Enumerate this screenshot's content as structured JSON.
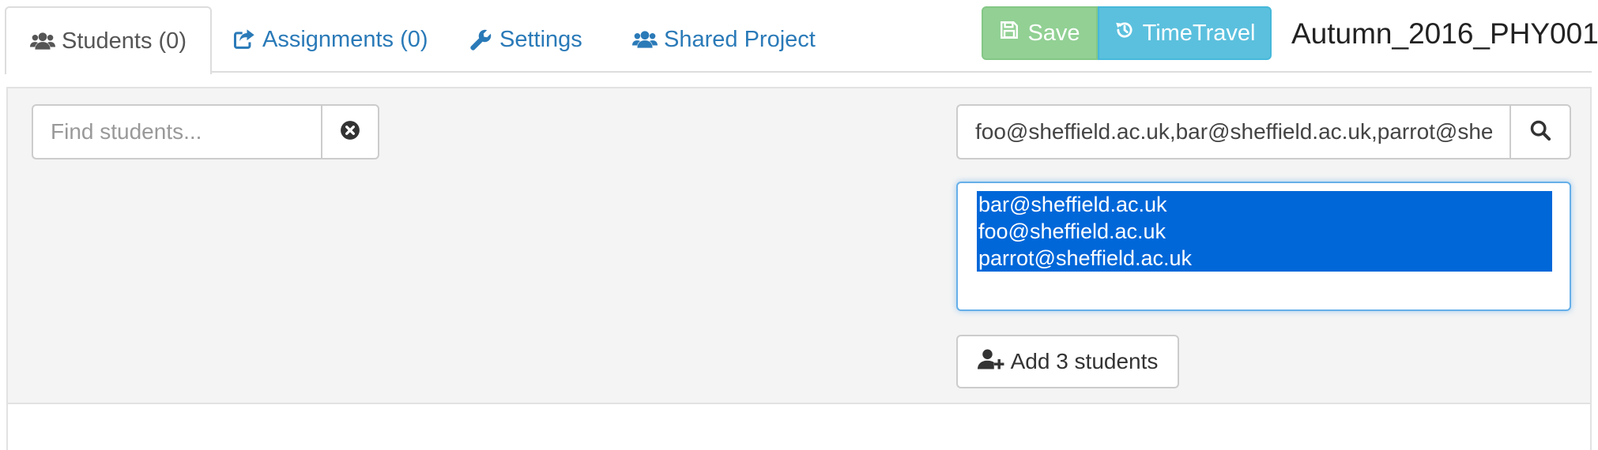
{
  "tabs": [
    {
      "label": "Students (0)",
      "icon": "users-icon",
      "active": true
    },
    {
      "label": "Assignments (0)",
      "icon": "share-square-icon",
      "active": false
    },
    {
      "label": "Settings",
      "icon": "wrench-icon",
      "active": false
    },
    {
      "label": "Shared Project",
      "icon": "users-icon",
      "active": false
    }
  ],
  "toolbar": {
    "save_label": "Save",
    "save_icon": "floppy-disk-icon",
    "timetravel_label": "TimeTravel",
    "timetravel_icon": "history-icon"
  },
  "course": {
    "title": "Autumn_2016_PHY001"
  },
  "find": {
    "placeholder": "Find students...",
    "value": ""
  },
  "add_search": {
    "value": "foo@sheffield.ac.uk,bar@sheffield.ac.uk,parrot@sheffield.ac.uk"
  },
  "results": [
    "bar@sheffield.ac.uk",
    "foo@sheffield.ac.uk",
    "parrot@sheffield.ac.uk"
  ],
  "add_button": {
    "label": "Add 3 students",
    "icon": "user-plus-icon"
  },
  "colors": {
    "link": "#2a7ab8",
    "save_bg": "#92d094",
    "timetravel_bg": "#5bc0de",
    "selection_bg": "#0067d9",
    "panel_bg": "#f4f4f4"
  }
}
